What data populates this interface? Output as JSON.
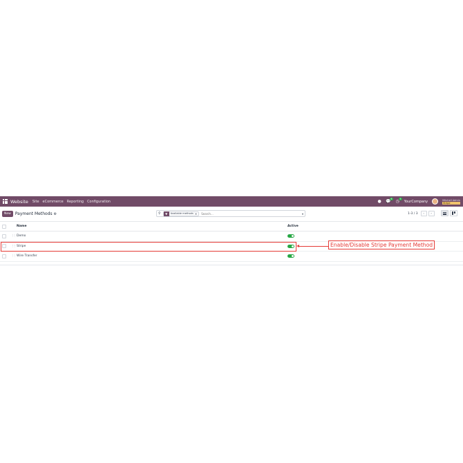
{
  "navbar": {
    "brand": "Website",
    "menu": [
      "Site",
      "eCommerce",
      "Reporting",
      "Configuration"
    ],
    "chat_badge": "6",
    "activity_badge": "5",
    "company": "YourCompany",
    "user_name": "Mitchell Admin",
    "user_db": "Stripe",
    "color": "#714b67"
  },
  "control": {
    "new_label": "New",
    "title": "Payment Methods",
    "facet_label": "Available methods",
    "search_placeholder": "Search...",
    "pager": "1-3 / 3"
  },
  "list": {
    "columns": {
      "name": "Name",
      "active": "Active"
    },
    "rows": [
      {
        "name": "Demo",
        "active": true
      },
      {
        "name": "Stripe",
        "active": true
      },
      {
        "name": "Wire Transfer",
        "active": true
      }
    ]
  },
  "annotation": {
    "callout": "Enable/Disable Stripe Payment Method",
    "color": "#e53935"
  },
  "icons": {
    "apps": "apps-grid-icon",
    "search": "search-icon",
    "settings": "gear-icon",
    "filter": "filter-icon"
  }
}
